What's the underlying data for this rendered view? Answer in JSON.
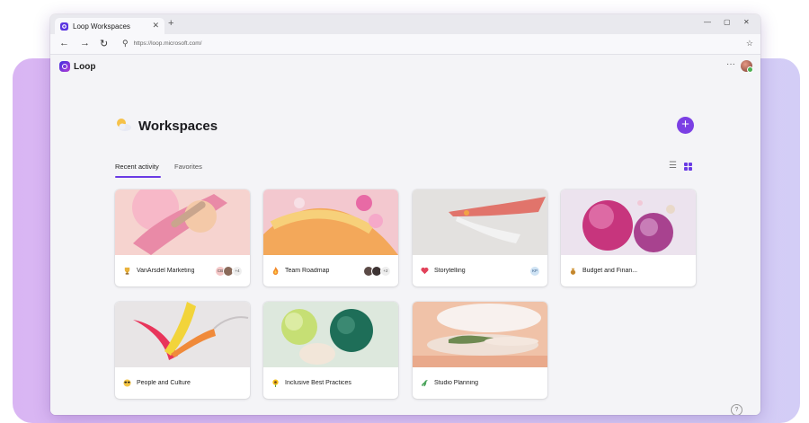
{
  "browser": {
    "tab_title": "Loop Workspaces",
    "tab_close": "✕",
    "new_tab": "+",
    "url": "https://loop.microsoft.com/",
    "window_controls": [
      "—",
      "▢",
      "✕"
    ]
  },
  "app": {
    "name": "Loop",
    "more": "···"
  },
  "page": {
    "title": "Workspaces",
    "add_button": "+",
    "tabs": [
      {
        "label": "Recent activity",
        "active": true
      },
      {
        "label": "Favorites",
        "active": false
      }
    ],
    "help": "?"
  },
  "colors": {
    "accent": "#7b3fe4",
    "background": "#f4f4f7",
    "backdrop": "#d9b5f3"
  },
  "workspaces": [
    {
      "name": "VanArsdel Marketing",
      "emoji_icon": "trophy-icon",
      "people": [
        "CB",
        ""
      ],
      "more_count": "+4"
    },
    {
      "name": "Team Roadmap",
      "emoji_icon": "flame-icon",
      "people": [
        "",
        ""
      ],
      "more_count": "+2"
    },
    {
      "name": "Storytelling",
      "emoji_icon": "heart-icon",
      "people": [
        "KP"
      ],
      "more_count": ""
    },
    {
      "name": "Budget and Finan...",
      "emoji_icon": "money-bag-icon",
      "people": [],
      "more_count": ""
    },
    {
      "name": "People and Culture",
      "emoji_icon": "sunglasses-icon",
      "people": [],
      "more_count": ""
    },
    {
      "name": "Inclusive Best Practices",
      "emoji_icon": "sunflower-icon",
      "people": [],
      "more_count": ""
    },
    {
      "name": "Studio Planning",
      "emoji_icon": "dinosaur-icon",
      "people": [],
      "more_count": ""
    }
  ]
}
